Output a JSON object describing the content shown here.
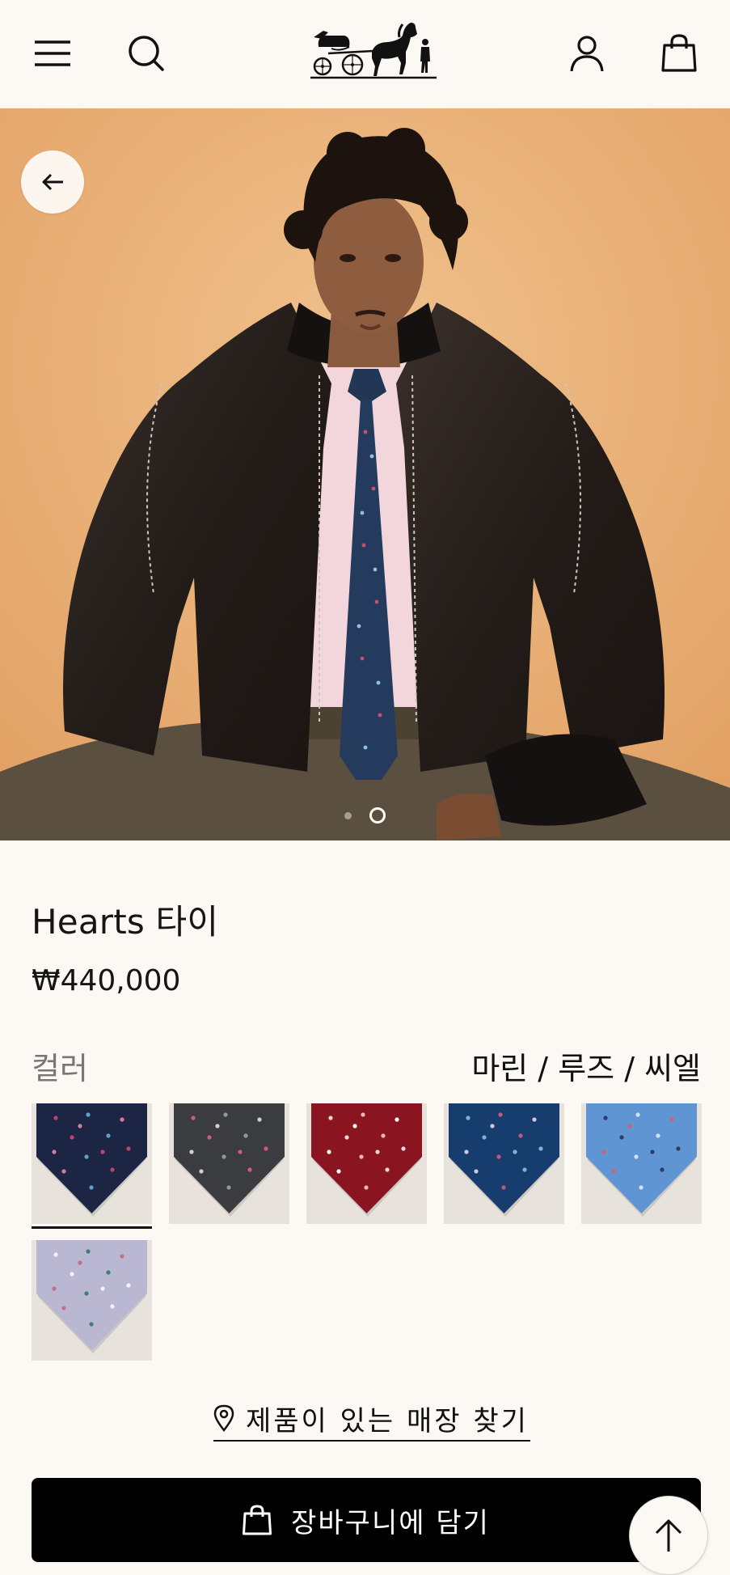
{
  "header": {
    "menu_icon": "hamburger-icon",
    "search_icon": "search-icon",
    "logo": "horse-carriage-logo",
    "account_icon": "user-icon",
    "cart_icon": "shopping-bag-icon"
  },
  "gallery": {
    "back_icon": "arrow-left-icon",
    "image_count": 2,
    "active_index": 1,
    "image_description": "model wearing tie"
  },
  "product": {
    "title": "Hearts 타이",
    "price": "₩440,000"
  },
  "color": {
    "label": "컬러",
    "selected": "마린 / 루즈 / 씨엘",
    "swatches": [
      {
        "color": "#1c2543",
        "dots": [
          "#c1436a",
          "#5ba3c9",
          "#d57fa0"
        ]
      },
      {
        "color": "#3a3c3f",
        "dots": [
          "#d35a78",
          "#8a9aa6",
          "#d0d0d0"
        ]
      },
      {
        "color": "#8a1420",
        "dots": [
          "#f1d8dc",
          "#f3b5c0",
          "#ffffff"
        ]
      },
      {
        "color": "#163d6e",
        "dots": [
          "#7fb4d8",
          "#c5587a",
          "#d3c6e0"
        ]
      },
      {
        "color": "#5f95d3",
        "dots": [
          "#2b3c67",
          "#cfe4f6",
          "#d65c7a"
        ]
      },
      {
        "color": "#bab7d2",
        "dots": [
          "#f3f2fb",
          "#3e7e6d",
          "#c2708a"
        ]
      }
    ]
  },
  "actions": {
    "store_locator": "제품이 있는 매장 찾기",
    "store_icon": "location-pin-icon",
    "add_to_cart": "장바구니에 담기",
    "add_to_cart_icon": "shopping-bag-icon",
    "scroll_top_icon": "arrow-up-icon"
  }
}
